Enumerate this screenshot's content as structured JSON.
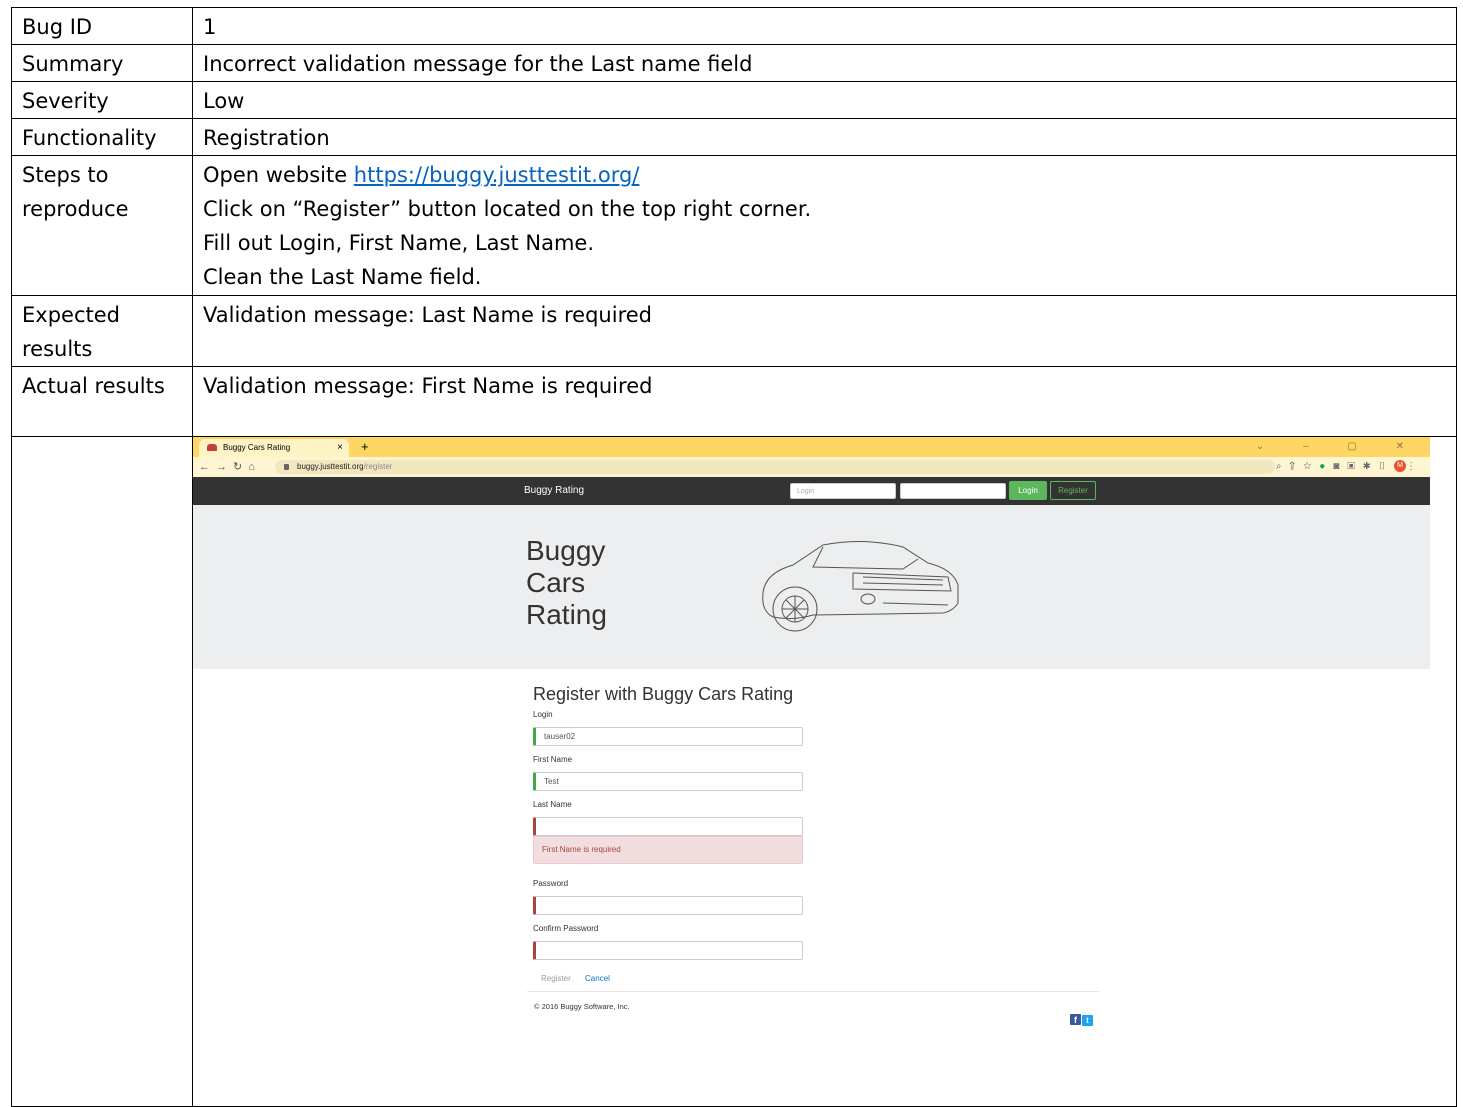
{
  "report": {
    "rows": [
      {
        "label": "Bug ID",
        "value": "1"
      },
      {
        "label": "Summary",
        "value": "Incorrect validation message for the Last name field"
      },
      {
        "label": "Severity",
        "value": "Low"
      },
      {
        "label": "Functionality",
        "value": "Registration"
      }
    ],
    "steps": {
      "label": "Steps to reproduce",
      "line1_prefix": "Open website ",
      "link": "https://buggy.justtestit.org/",
      "line2": "Click on “Register” button located on the top right corner.",
      "line3": "Fill out Login, First Name, Last Name.",
      "line4": "Clean the Last Name field."
    },
    "expected": {
      "label": "Expected results",
      "value": "Validation message: Last Name is required"
    },
    "actual": {
      "label": "Actual results",
      "value": "Validation message: First Name is required"
    }
  },
  "browser": {
    "tab_title": "Buggy Cars Rating",
    "tab_close": "×",
    "new_tab": "+",
    "url_host": "buggy.justtestit.org",
    "url_path": "/register",
    "avatar_letter": "M"
  },
  "site": {
    "brand": "Buggy Rating",
    "login_placeholder": "Login",
    "login_button": "Login",
    "register_button": "Register",
    "hero_title": "Buggy\nCars\nRating"
  },
  "form": {
    "title": "Register with Buggy Cars Rating",
    "login_label": "Login",
    "login_value": "tauser02",
    "first_name_label": "First Name",
    "first_name_value": "Test",
    "last_name_label": "Last Name",
    "last_name_value": "",
    "error_message": "First Name is required",
    "password_label": "Password",
    "confirm_password_label": "Confirm Password",
    "register_button": "Register",
    "cancel_button": "Cancel"
  },
  "footer": {
    "copyright": "© 2016 Buggy Software, Inc."
  },
  "colors": {
    "link": "#0563c1",
    "tab_bar": "#fdd663",
    "nav_dark": "#333333",
    "success": "#5cb85c",
    "error": "#a94442"
  }
}
